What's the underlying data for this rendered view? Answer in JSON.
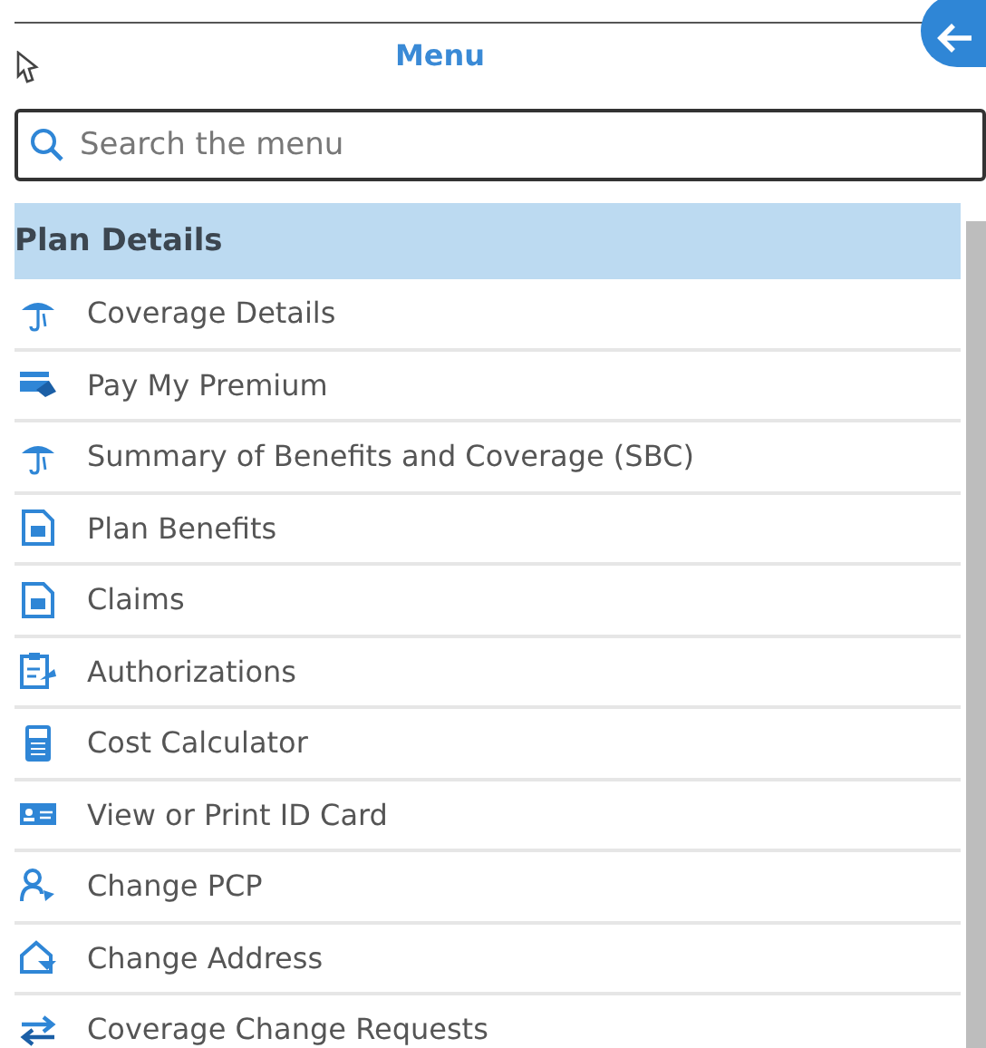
{
  "header": {
    "title": "Menu"
  },
  "search": {
    "placeholder": "Search the menu"
  },
  "section": {
    "title": "Plan Details"
  },
  "items": [
    {
      "label": "Coverage Details",
      "kind": "umbrella"
    },
    {
      "label": "Pay My Premium",
      "kind": "payment"
    },
    {
      "label": "Summary of Benefits and Coverage (SBC)",
      "kind": "umbrella"
    },
    {
      "label": "Plan Benefits",
      "kind": "document"
    },
    {
      "label": "Claims",
      "kind": "document"
    },
    {
      "label": "Authorizations",
      "kind": "clipboard"
    },
    {
      "label": "Cost Calculator",
      "kind": "calculator"
    },
    {
      "label": "View or Print ID Card",
      "kind": "idcard"
    },
    {
      "label": "Change PCP",
      "kind": "person"
    },
    {
      "label": "Change Address",
      "kind": "house"
    },
    {
      "label": "Coverage Change Requests",
      "kind": "arrows"
    }
  ]
}
